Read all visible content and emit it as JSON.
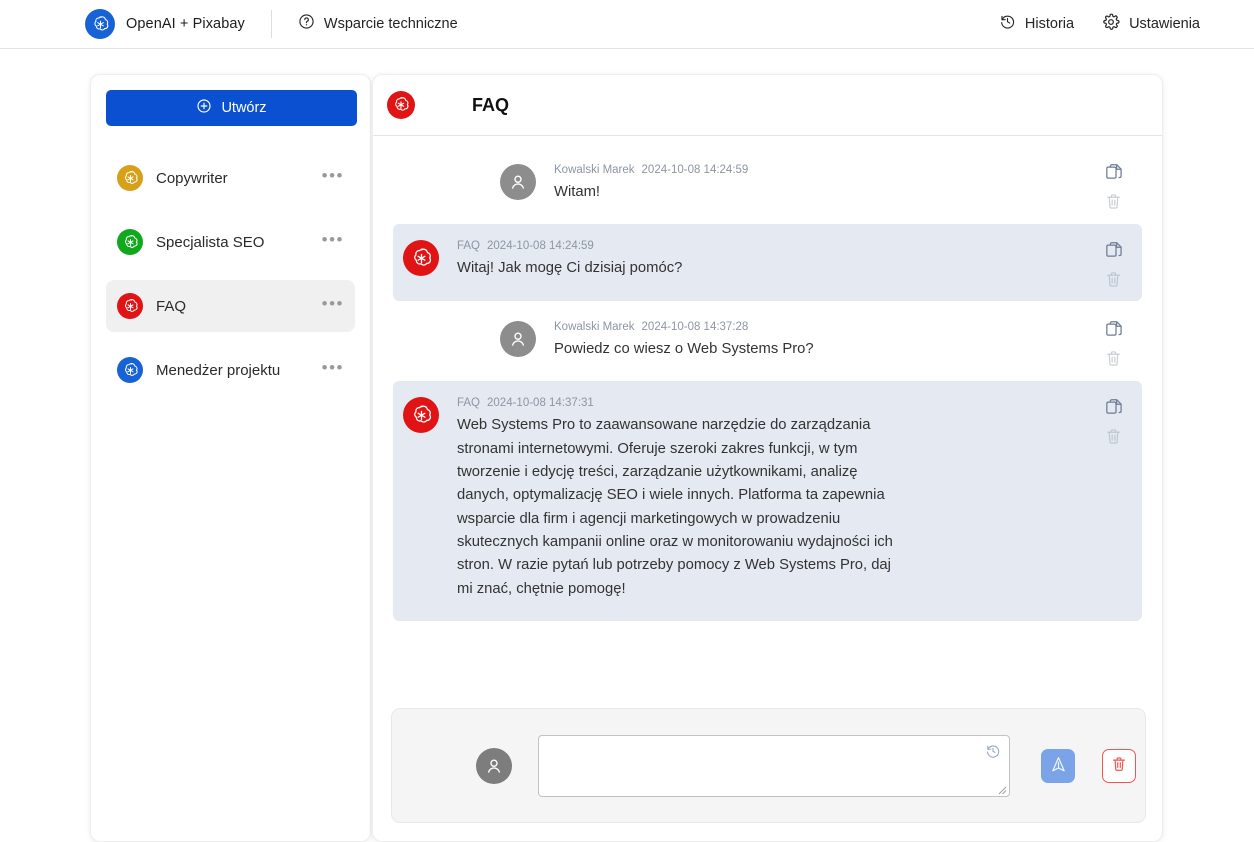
{
  "topbar": {
    "brand": {
      "name": "OpenAI + Pixabay",
      "logo_icon": "openai-logo-icon",
      "logo_color": "#1763d6"
    },
    "support": {
      "label": "Wsparcie techniczne",
      "icon": "question-circle-icon"
    },
    "history": {
      "label": "Historia",
      "icon": "history-icon"
    },
    "settings": {
      "label": "Ustawienia",
      "icon": "gear-icon"
    }
  },
  "sidebar": {
    "create_button": {
      "label": "Utwórz",
      "icon": "plus-circle-icon",
      "color": "#0b50d0"
    },
    "items": [
      {
        "label": "Copywriter",
        "icon": "openai-logo-icon",
        "color": "#d6a01a",
        "active": false,
        "menu": "•••"
      },
      {
        "label": "Specjalista SEO",
        "icon": "openai-logo-icon",
        "color": "#11a81e",
        "active": false,
        "menu": "•••"
      },
      {
        "label": "FAQ",
        "icon": "openai-logo-icon",
        "color": "#e01414",
        "active": true,
        "menu": "•••"
      },
      {
        "label": "Menedżer projektu",
        "icon": "openai-logo-icon",
        "color": "#1763d6",
        "active": false,
        "menu": "•••"
      }
    ]
  },
  "chat": {
    "header": {
      "title": "FAQ",
      "avatar_icon": "openai-logo-icon",
      "avatar_color": "#e01414"
    },
    "messages": [
      {
        "role": "user",
        "author": "Kowalski Marek",
        "timestamp": "2024-10-08 14:24:59",
        "text": "Witam!",
        "avatar_icon": "user-avatar-icon",
        "copy_icon": "copy-icon",
        "delete_icon": "trash-icon"
      },
      {
        "role": "assistant",
        "author": "FAQ",
        "timestamp": "2024-10-08 14:24:59",
        "text": "Witaj! Jak mogę Ci dzisiaj pomóc?",
        "avatar_icon": "openai-logo-icon",
        "copy_icon": "copy-icon",
        "delete_icon": "trash-icon"
      },
      {
        "role": "user",
        "author": "Kowalski Marek",
        "timestamp": "2024-10-08 14:37:28",
        "text": "Powiedz co wiesz o Web Systems Pro?",
        "avatar_icon": "user-avatar-icon",
        "copy_icon": "copy-icon",
        "delete_icon": "trash-icon"
      },
      {
        "role": "assistant",
        "author": "FAQ",
        "timestamp": "2024-10-08 14:37:31",
        "text": "Web Systems Pro to zaawansowane narzędzie do zarządzania stronami internetowymi. Oferuje szeroki zakres funkcji, w tym tworzenie i edycję treści, zarządzanie użytkownikami, analizę danych, optymalizację SEO i wiele innych. Platforma ta zapewnia wsparcie dla firm i agencji marketingowych w prowadzeniu skutecznych kampanii online oraz w monitorowaniu wydajności ich stron. W razie pytań lub potrzeby pomocy z Web Systems Pro, daj mi znać, chętnie pomogę!",
        "avatar_icon": "openai-logo-icon",
        "copy_icon": "copy-icon",
        "delete_icon": "trash-icon"
      }
    ],
    "composer": {
      "avatar_icon": "user-avatar-icon",
      "input_value": "",
      "input_placeholder": "",
      "restore_icon": "restore-history-icon",
      "send_button": {
        "icon": "send-icon",
        "color": "#7ba4e8"
      },
      "clear_button": {
        "icon": "trash-icon",
        "color": "#f4554f"
      }
    }
  }
}
